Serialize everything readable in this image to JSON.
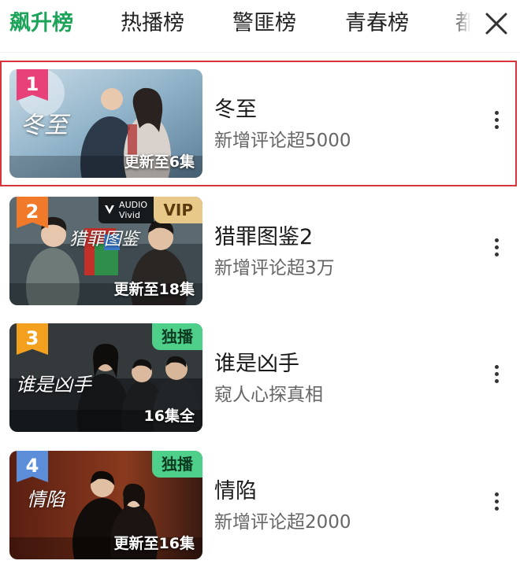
{
  "tabs": [
    {
      "label": "飙升榜",
      "active": true
    },
    {
      "label": "热播榜",
      "active": false
    },
    {
      "label": "警匪榜",
      "active": false
    },
    {
      "label": "青春榜",
      "active": false
    },
    {
      "label": "都",
      "active": false
    }
  ],
  "close_icon": "close-icon",
  "items": [
    {
      "rank": "1",
      "rank_color": "#e8417a",
      "title": "冬至",
      "subtitle": "新增评论超5000",
      "episode_label": "更新至6集",
      "poster_text": "冬至",
      "badge": "",
      "highlighted": true
    },
    {
      "rank": "2",
      "rank_color": "#f07a2a",
      "title": "猎罪图鉴2",
      "subtitle": "新增评论超3万",
      "episode_label": "更新至18集",
      "poster_text": "猎罪图鉴",
      "badge": "VIP",
      "audio_tag_line1": "AUDIO",
      "audio_tag_line2": "Vivid"
    },
    {
      "rank": "3",
      "rank_color": "#f2a01e",
      "title": "谁是凶手",
      "subtitle": "窥人心探真相",
      "episode_label": "16集全",
      "poster_text": "谁是凶手",
      "badge": "独播"
    },
    {
      "rank": "4",
      "rank_color": "#5b8dd9",
      "title": "情陷",
      "subtitle": "新增评论超2000",
      "episode_label": "更新至16集",
      "poster_text": "情陷",
      "badge": "独播"
    }
  ],
  "colors": {
    "accent": "#1ea45a",
    "highlight_border": "#d9343a"
  }
}
